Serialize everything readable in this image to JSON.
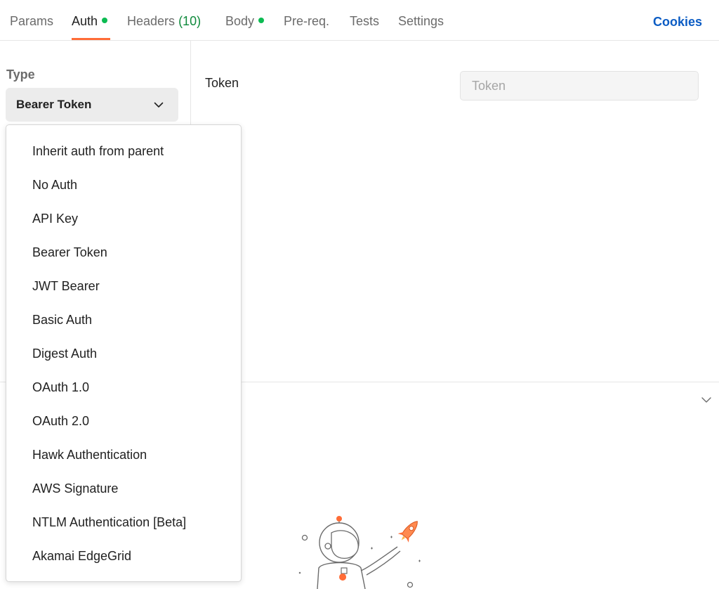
{
  "tabs": [
    {
      "label": "Params",
      "count": "",
      "dot": false,
      "active": false
    },
    {
      "label": "Auth",
      "count": "",
      "dot": true,
      "active": true
    },
    {
      "label": "Headers",
      "count": "(10)",
      "dot": false,
      "active": false
    },
    {
      "label": "Body",
      "count": "",
      "dot": true,
      "active": false
    },
    {
      "label": "Pre-req.",
      "count": "",
      "dot": false,
      "active": false
    },
    {
      "label": "Tests",
      "count": "",
      "dot": false,
      "active": false
    },
    {
      "label": "Settings",
      "count": "",
      "dot": false,
      "active": false
    }
  ],
  "cookies_label": "Cookies",
  "auth": {
    "type_label": "Type",
    "selected_type": "Bearer Token",
    "token_label": "Token",
    "token_placeholder": "Token",
    "token_value": ""
  },
  "dropdown": {
    "options": [
      "Inherit auth from parent",
      "No Auth",
      "API Key",
      "Bearer Token",
      "JWT Bearer",
      "Basic Auth",
      "Digest Auth",
      "OAuth 1.0",
      "OAuth 2.0",
      "Hawk Authentication",
      "AWS Signature",
      "NTLM Authentication [Beta]",
      "Akamai EdgeGrid"
    ]
  },
  "colors": {
    "active_tab_underline": "#ff6c37",
    "status_dot": "#0cbb52",
    "headers_count": "#0f8a3c",
    "cookies_link": "#0b5cc4"
  },
  "icons": {
    "select_chevron": "chevron-down-icon",
    "response_toggle": "chevron-down-icon",
    "empty_state": "astronaut-rocket-illustration"
  }
}
